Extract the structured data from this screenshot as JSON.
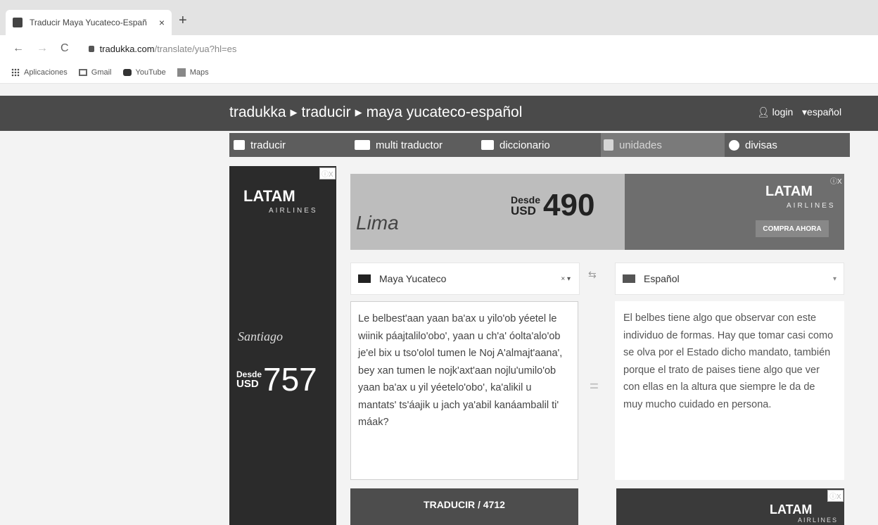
{
  "browser": {
    "tab_title": "Traducir Maya Yucateco-Españ",
    "tab_close": "×",
    "new_tab": "+",
    "back": "←",
    "forward": "→",
    "reload": "C",
    "url_host": "tradukka.com",
    "url_path": "/translate/yua?hl=es",
    "bookmarks": [
      {
        "label": "Aplicaciones",
        "icon": "apps-grid-icon"
      },
      {
        "label": "Gmail",
        "icon": "gmail-icon"
      },
      {
        "label": "YouTube",
        "icon": "youtube-icon"
      },
      {
        "label": "Maps",
        "icon": "maps-icon"
      }
    ]
  },
  "site": {
    "breadcrumb": [
      "tradukka",
      "traducir",
      "maya yucateco-español"
    ],
    "breadcrumb_sep": "▶",
    "login": "login",
    "language": "español",
    "nav": [
      {
        "label": "traducir",
        "icon": "chat-icon"
      },
      {
        "label": "multi traductor",
        "icon": "multi-chat-icon"
      },
      {
        "label": "diccionario",
        "icon": "book-icon"
      },
      {
        "label": "unidades",
        "icon": "bars-icon"
      },
      {
        "label": "divisas",
        "icon": "coin-icon"
      }
    ]
  },
  "ads": {
    "left": {
      "brand": "LATAM",
      "sub": "AIRLINES",
      "city": "Santiago",
      "desde": "Desde",
      "currency": "USD",
      "price": "757"
    },
    "top": {
      "city": "Lima",
      "desde": "Desde",
      "currency": "USD",
      "price": "490",
      "brand": "LATAM",
      "sub": "AIRLINES",
      "cta": "COMPRA AHORA"
    },
    "bottom": {
      "brand": "LATAM",
      "sub": "AIRLINES"
    },
    "adchoices": "ⓘX"
  },
  "translator": {
    "source_lang": "Maya Yucateco",
    "source_controls": "× ▾",
    "swap": "⇆",
    "target_lang": "Español",
    "target_caret": "▾",
    "equals": "=",
    "source_text": "Le belbest'aan yaan ba'ax u yilo'ob yéetel le wiinik páajtalilo'obo', yaan u ch'a' óolta'alo'ob je'el bix u tso'olol tumen le Noj A'almajt'aana', bey xan tumen le nojk'axt'aan nojlu'umilo'ob yaan ba'ax u yil yéetelo'obo', ka'alikil u mantats' ts'áajik u jach ya'abil kanáambalil ti' máak?",
    "target_text": "El belbes tiene algo que observar con este individuo de formas. Hay que tomar casi como se olva por el Estado dicho mandato, también porque el trato de paises tiene algo que ver con ellas en la altura que siempre le da de muy mucho cuidado en persona.",
    "button_label": "TRADUCIR / 4712"
  }
}
